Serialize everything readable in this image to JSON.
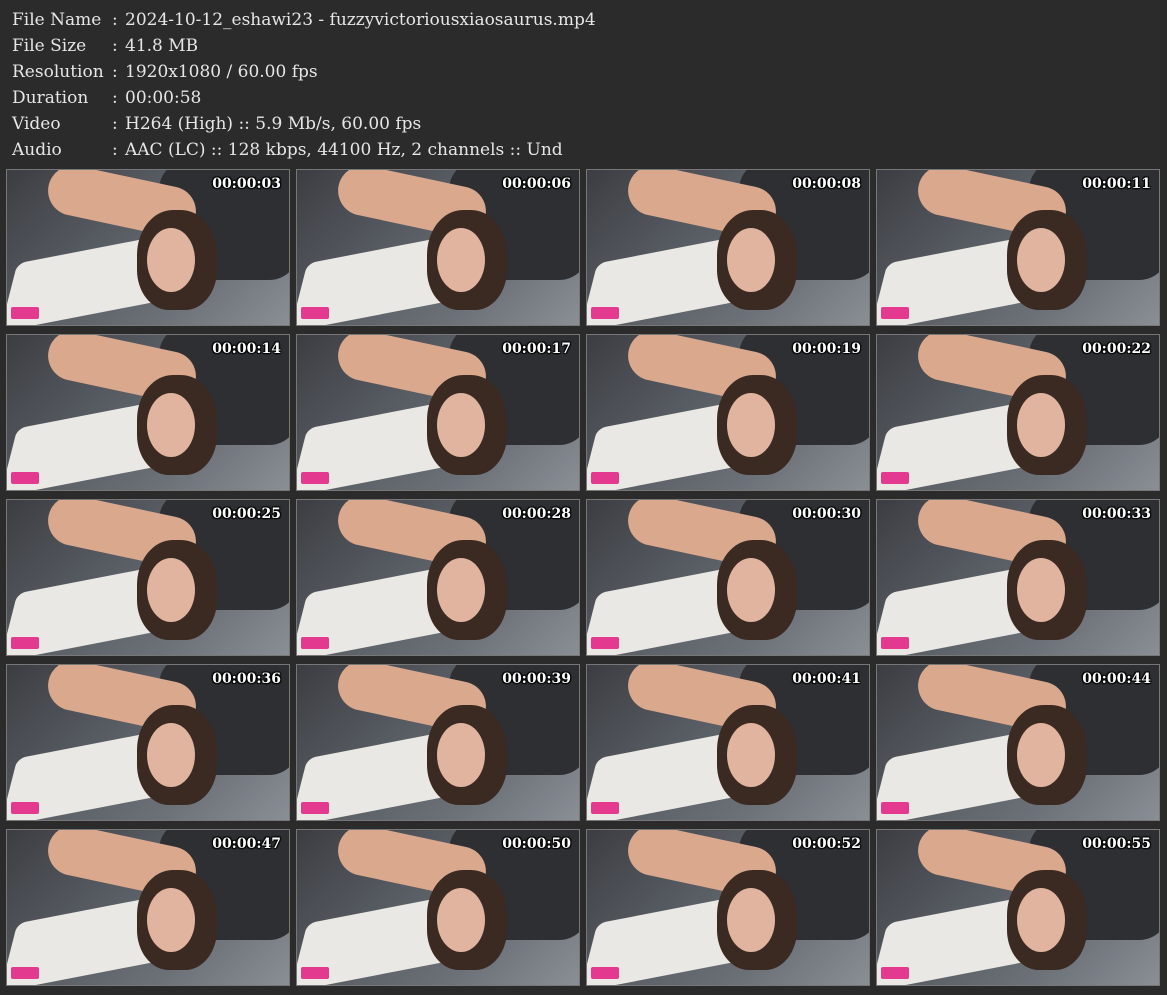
{
  "info": [
    {
      "label": "File Name",
      "value": "2024-10-12_eshawi23 - fuzzyvictoriousxiaosaurus.mp4"
    },
    {
      "label": "File Size",
      "value": "41.8 MB"
    },
    {
      "label": "Resolution",
      "value": "1920x1080 / 60.00 fps"
    },
    {
      "label": "Duration",
      "value": "00:00:58"
    },
    {
      "label": "Video",
      "value": "H264 (High) :: 5.9 Mb/s, 60.00 fps"
    },
    {
      "label": "Audio",
      "value": "AAC (LC) :: 128 kbps, 44100 Hz, 2 channels :: Und"
    }
  ],
  "separator": ":",
  "thumbnails": [
    "00:00:03",
    "00:00:06",
    "00:00:08",
    "00:00:11",
    "00:00:14",
    "00:00:17",
    "00:00:19",
    "00:00:22",
    "00:00:25",
    "00:00:28",
    "00:00:30",
    "00:00:33",
    "00:00:36",
    "00:00:39",
    "00:00:41",
    "00:00:44",
    "00:00:47",
    "00:00:50",
    "00:00:52",
    "00:00:55"
  ],
  "colors": {
    "background": "#2b2b2b",
    "text": "#e6e6e6",
    "logo": "#e3398f"
  }
}
